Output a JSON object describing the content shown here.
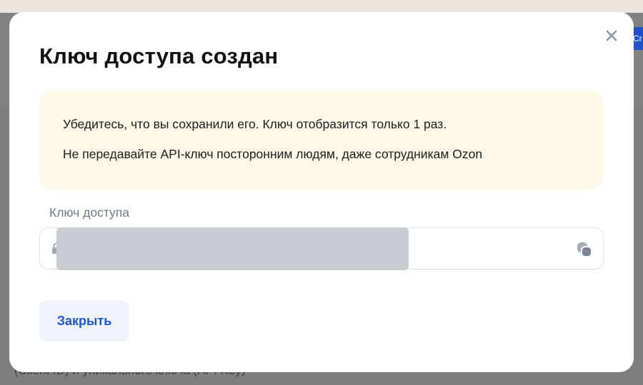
{
  "background": {
    "button_fragment": "Cr",
    "bottom_text": "(Client ID) и уникального ключа (API Key)"
  },
  "modal": {
    "title": "Ключ доступа создан",
    "close_icon": "close-icon",
    "notice": {
      "line1": "Убедитесь, что вы сохранили его. Ключ отобразится только 1 раз.",
      "line2": "Не передавайте API-ключ посторонним людям, даже сотрудникам Ozon"
    },
    "key_field": {
      "label": "Ключ доступа",
      "value_redacted": true,
      "lock_icon": "lock-icon",
      "copy_icon": "copy-icon"
    },
    "close_button": "Закрыть"
  },
  "colors": {
    "accent": "#1e54d6",
    "button_bg": "#eef3fc",
    "notice_bg": "#fdf8e7",
    "redaction": "#c7cbd2"
  }
}
